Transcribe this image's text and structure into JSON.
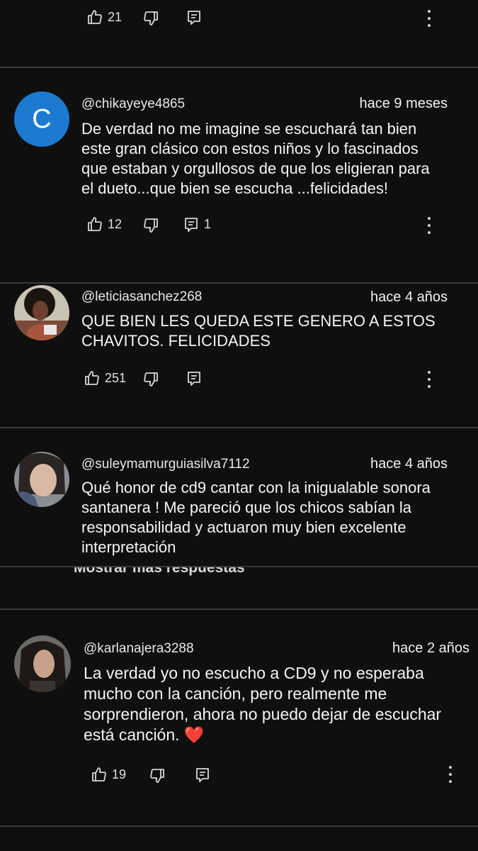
{
  "comments": [
    {
      "likes": "21",
      "replies": ""
    },
    {
      "handle": "@chikayeye4865",
      "time": "hace 9 meses",
      "avatar_letter": "C",
      "avatar_color": "#1c7ad1",
      "text": "De verdad no me imagine se escuchará tan bien\neste gran clásico con estos niños y lo fascinados\nque estaban y orgullosos de que los eligieran para\nel dueto...que bien se escucha ...felicidades!",
      "likes": "12",
      "replies": "1"
    },
    {
      "handle": "@leticiasanchez268",
      "time": "hace 4 años",
      "text": "QUE BIEN LES QUEDA ESTE GENERO A ESTOS\nCHAVITOS. FELICIDADES",
      "likes": "251",
      "replies": ""
    },
    {
      "handle": "@suleymamurguiasilva7112",
      "time": "hace 4 años",
      "text": "Qué honor de cd9 cantar con la inigualable sonora\nsantanera ! Me pareció que los chicos sabían la\nresponsabilidad y actuaron muy bien excelente\ninterpretación"
    },
    {
      "handle": "@karlanajera3288",
      "time": "hace 2 años",
      "text": "La verdad yo no escucho a CD9 y no esperaba\nmucho con la canción, pero realmente me\nsorprendieron,  ahora no puedo dejar de escuchar\nestá canción. ",
      "emoji": "❤️",
      "likes": "19",
      "replies": ""
    }
  ],
  "show_more_replies": "Mostrar más respuestas",
  "icons": [
    "like-icon",
    "dislike-icon",
    "reply-icon",
    "more-vert-icon"
  ],
  "colors": {
    "background": "#0f0f0f",
    "divider": "#3a3a3a",
    "heart": "#e0243a"
  }
}
